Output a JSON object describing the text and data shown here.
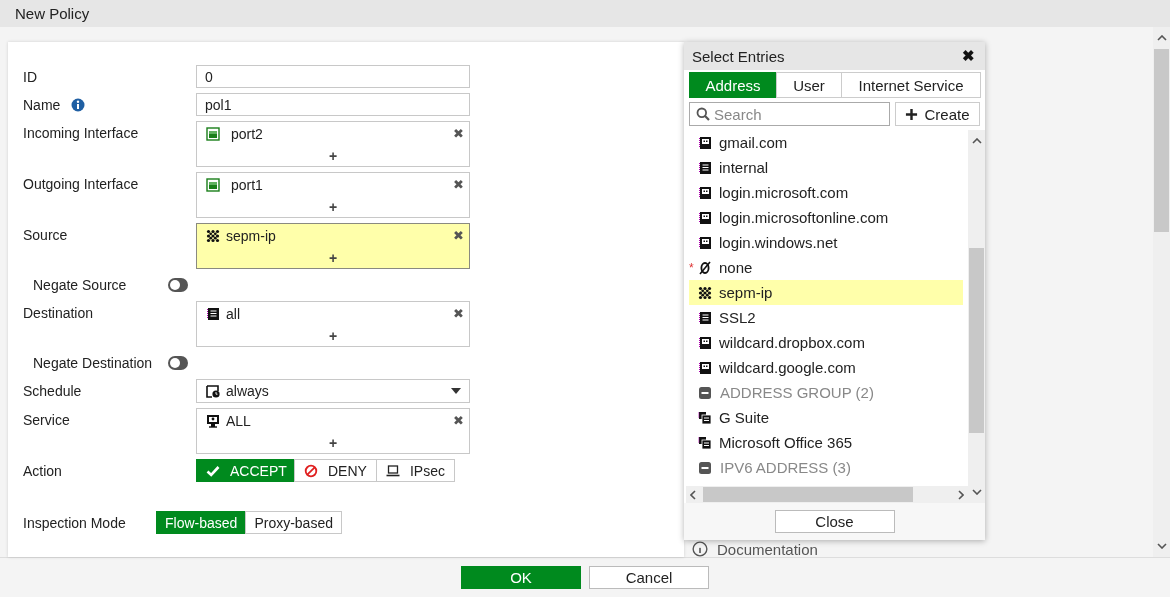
{
  "title": "New Policy",
  "form": {
    "fields": [
      {
        "kind": "text",
        "label": "ID",
        "value": "0"
      },
      {
        "kind": "text",
        "label": "Name",
        "value": "pol1",
        "info": true
      },
      {
        "kind": "multi",
        "label": "Incoming Interface",
        "highlighted": false,
        "add": "+",
        "entries": [
          {
            "kind": "port",
            "text": "port2",
            "remove": "✖"
          }
        ]
      },
      {
        "kind": "multi",
        "label": "Outgoing Interface",
        "highlighted": false,
        "add": "+",
        "entries": [
          {
            "kind": "port",
            "text": "port1",
            "remove": "✖"
          }
        ]
      },
      {
        "kind": "multi",
        "label": "Source",
        "highlighted": true,
        "add": "+",
        "entries": [
          {
            "kind": "wildcard",
            "text": "sepm-ip",
            "remove": "✖"
          }
        ]
      },
      {
        "kind": "toggle",
        "label": "Negate Source",
        "on": false
      },
      {
        "kind": "multi",
        "label": "Destination",
        "highlighted": false,
        "add": "+",
        "entries": [
          {
            "kind": "subnet",
            "text": "all",
            "remove": "✖"
          }
        ]
      },
      {
        "kind": "toggle",
        "label": "Negate Destination",
        "on": false
      },
      {
        "kind": "select",
        "label": "Schedule",
        "value": "always"
      },
      {
        "kind": "multi",
        "label": "Service",
        "highlighted": false,
        "add": "+",
        "entries": [
          {
            "kind": "service",
            "text": "ALL",
            "remove": "✖"
          }
        ]
      },
      {
        "kind": "buttons",
        "label": "Action",
        "options": [
          {
            "kind": "accept",
            "text": "ACCEPT",
            "selected": true
          },
          {
            "kind": "deny",
            "text": "DENY",
            "selected": false
          },
          {
            "kind": "ipsec",
            "text": "IPsec",
            "selected": false
          }
        ]
      },
      {
        "kind": "inline-buttons",
        "label": "Inspection Mode",
        "options": [
          {
            "text": "Flow-based",
            "selected": true
          },
          {
            "text": "Proxy-based",
            "selected": false
          }
        ]
      }
    ]
  },
  "documentation": "Documentation",
  "popup": {
    "title": "Select Entries",
    "close": "✖",
    "tabs": [
      {
        "text": "Address",
        "selected": true
      },
      {
        "text": "User",
        "selected": false
      },
      {
        "text": "Internet Service",
        "selected": false
      }
    ],
    "search": {
      "placeholder": "Search"
    },
    "create": "Create",
    "items": [
      {
        "kind": "fqdn",
        "text": "gmail.com",
        "selected": false
      },
      {
        "kind": "subnet",
        "text": "internal",
        "selected": false
      },
      {
        "kind": "fqdn",
        "text": "login.microsoft.com",
        "selected": false
      },
      {
        "kind": "fqdn",
        "text": "login.microsoftonline.com",
        "selected": false
      },
      {
        "kind": "fqdn",
        "text": "login.windows.net",
        "selected": false
      },
      {
        "kind": "none",
        "text": "none",
        "mark": "*",
        "selected": false
      },
      {
        "kind": "wildcard",
        "text": "sepm-ip",
        "selected": true
      },
      {
        "kind": "subnet",
        "text": "SSL2",
        "selected": false
      },
      {
        "kind": "fqdn",
        "text": "wildcard.dropbox.com",
        "selected": false
      },
      {
        "kind": "fqdn",
        "text": "wildcard.google.com",
        "selected": false
      },
      {
        "kind": "header",
        "text": "ADDRESS GROUP (2)"
      },
      {
        "kind": "group",
        "text": "G Suite",
        "selected": false
      },
      {
        "kind": "group",
        "text": "Microsoft Office 365",
        "selected": false
      },
      {
        "kind": "header",
        "text": "IPV6 ADDRESS (3)"
      }
    ],
    "close_button": "Close"
  },
  "footer": {
    "buttons": [
      {
        "text": "OK",
        "primary": true
      },
      {
        "text": "Cancel",
        "primary": false
      }
    ]
  }
}
